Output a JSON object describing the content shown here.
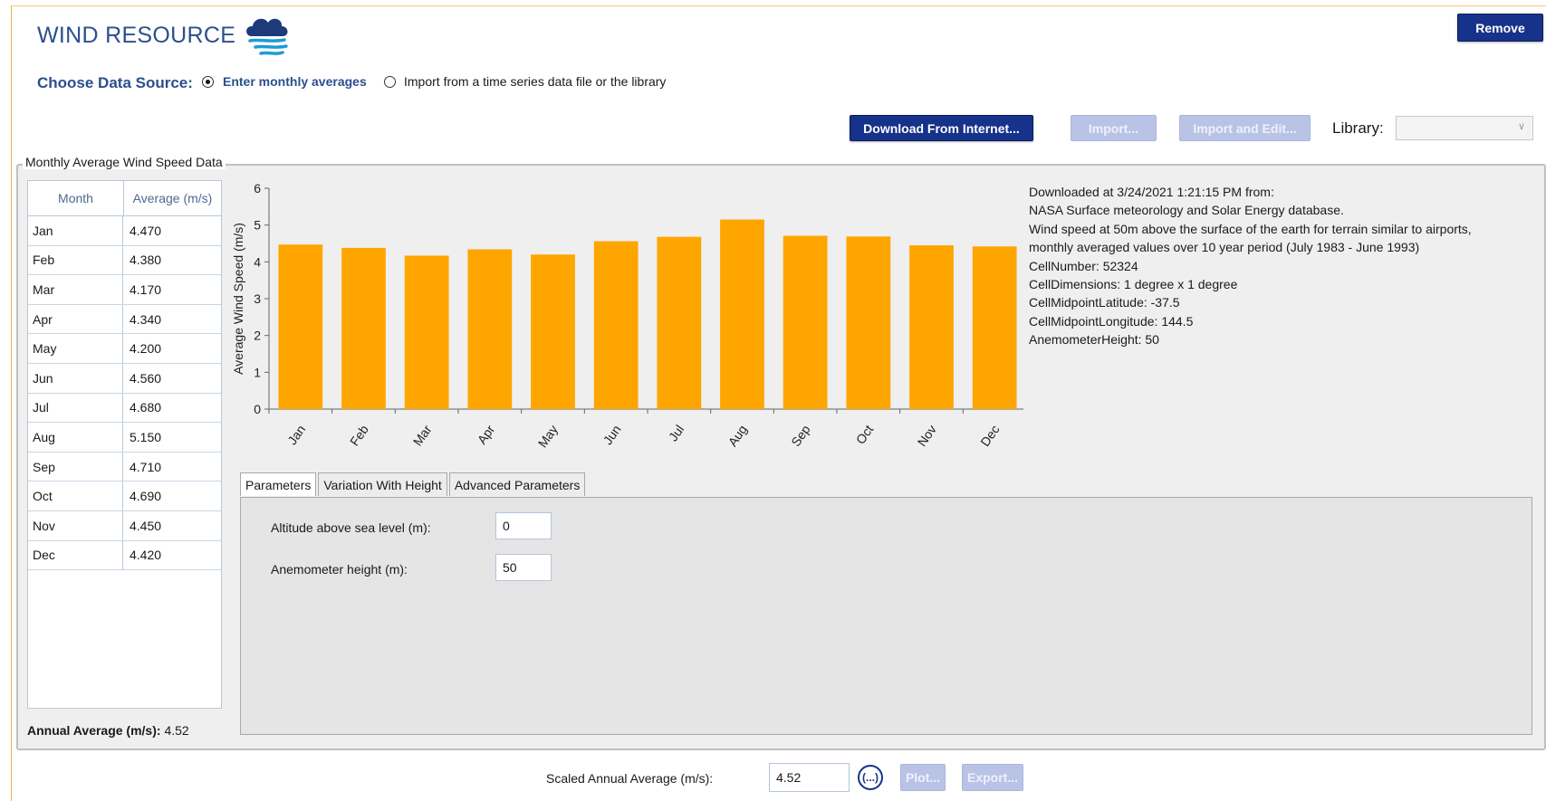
{
  "header": {
    "title": "WIND RESOURCE",
    "remove_label": "Remove"
  },
  "source": {
    "label": "Choose Data Source:",
    "options": [
      {
        "label": "Enter monthly averages",
        "selected": true
      },
      {
        "label": "Import from a time series data file or the library",
        "selected": false
      }
    ]
  },
  "toolbar": {
    "download_label": "Download From Internet...",
    "import_label": "Import...",
    "import_edit_label": "Import and Edit...",
    "library_label": "Library:",
    "library_value": ""
  },
  "group": {
    "legend": "Monthly Average Wind Speed Data"
  },
  "table": {
    "headers": [
      "Month",
      "Average (m/s)"
    ],
    "rows": [
      [
        "Jan",
        "4.470"
      ],
      [
        "Feb",
        "4.380"
      ],
      [
        "Mar",
        "4.170"
      ],
      [
        "Apr",
        "4.340"
      ],
      [
        "May",
        "4.200"
      ],
      [
        "Jun",
        "4.560"
      ],
      [
        "Jul",
        "4.680"
      ],
      [
        "Aug",
        "5.150"
      ],
      [
        "Sep",
        "4.710"
      ],
      [
        "Oct",
        "4.690"
      ],
      [
        "Nov",
        "4.450"
      ],
      [
        "Dec",
        "4.420"
      ]
    ]
  },
  "annual": {
    "label": "Annual Average (m/s):",
    "value": "4.52"
  },
  "chart_data": {
    "type": "bar",
    "categories": [
      "Jan",
      "Feb",
      "Mar",
      "Apr",
      "May",
      "Jun",
      "Jul",
      "Aug",
      "Sep",
      "Oct",
      "Nov",
      "Dec"
    ],
    "values": [
      4.47,
      4.38,
      4.17,
      4.34,
      4.2,
      4.56,
      4.68,
      5.15,
      4.71,
      4.69,
      4.45,
      4.42
    ],
    "ylabel": "Average Wind Speed (m/s)",
    "xlabel": "",
    "ylim": [
      0,
      6
    ],
    "yticks": [
      "0",
      "1",
      "2",
      "3",
      "4",
      "5",
      "6"
    ],
    "bar_color": "#ffa500",
    "grid": false
  },
  "info": {
    "lines": [
      "Downloaded at 3/24/2021 1:21:15 PM from:",
      "NASA Surface meteorology and Solar Energy database.",
      "Wind speed at 50m above the surface of the earth for terrain similar to airports,",
      "monthly averaged values over 10 year period (July 1983 - June 1993)",
      "CellNumber: 52324",
      "CellDimensions: 1 degree x 1 degree",
      "CellMidpointLatitude: -37.5",
      "CellMidpointLongitude: 144.5",
      "AnemometerHeight: 50"
    ]
  },
  "tabs": [
    "Parameters",
    "Variation With Height",
    "Advanced Parameters"
  ],
  "params": {
    "altitude_label": "Altitude above sea level (m):",
    "altitude_value": "0",
    "anemometer_label": "Anemometer height (m):",
    "anemometer_value": "50"
  },
  "footer": {
    "scaled_label": "Scaled Annual Average (m/s):",
    "scaled_value": "4.52",
    "ellipsis_label": "(...)",
    "plot_label": "Plot...",
    "export_label": "Export..."
  },
  "colors": {
    "accent": "#16328a",
    "title": "#2b4f8e",
    "bar": "#ffa500"
  }
}
